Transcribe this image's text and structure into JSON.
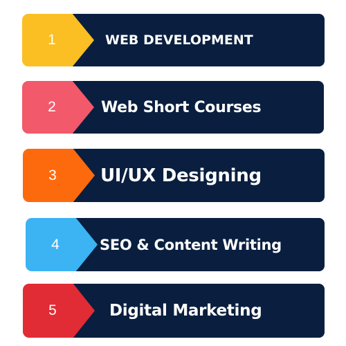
{
  "items": [
    {
      "number": "1",
      "label": "WEB DEVELOPMENT",
      "badge_color": "#fbbf24"
    },
    {
      "number": "2",
      "label": "Web Short Courses",
      "badge_color": "#f2596a"
    },
    {
      "number": "3",
      "label": "UI/UX Designing",
      "badge_color": "#fd6a0e"
    },
    {
      "number": "4",
      "label": "SEO & Content Writing",
      "badge_color": "#3cb3f3"
    },
    {
      "number": "5",
      "label": "Digital Marketing",
      "badge_color": "#e12c35"
    }
  ],
  "colors": {
    "bar": "#0a1f3f",
    "text": "#ffffff",
    "background": "#ffffff"
  }
}
